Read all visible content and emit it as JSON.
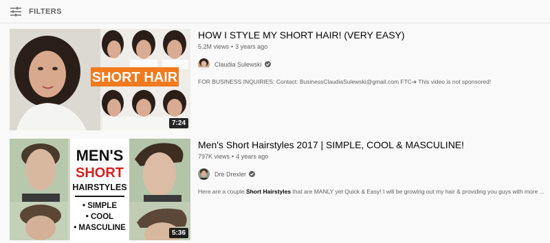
{
  "filters": {
    "label": "FILTERS"
  },
  "results": [
    {
      "title": "HOW I STYLE MY SHORT HAIR! (VERY EASY)",
      "views": "5.2M views",
      "age": "3 years ago",
      "channel": "Claudia Sulewski",
      "verified": true,
      "description": "FOR BUSINESS INQUIRIES: Contact: BusinessClaudiaSulewski@gmail.com FTC➔ This video is not sponsored!",
      "duration": "7:24",
      "thumb_text": "SHORT HAIR"
    },
    {
      "title": "Men's Short Hairstyles 2017 | SIMPLE, COOL & MASCULINE!",
      "views": "797K views",
      "age": "4 years ago",
      "channel": "Dre Drexler",
      "verified": true,
      "description_pre": "Here are a couple ",
      "description_bold": "Short Hairstyles",
      "description_post": " that are MANLY yet Quick & Easy! I will be growing out my hair & providing you guys with more ...",
      "duration": "5:36",
      "thumb_lines": [
        "MEN'S",
        "SHORT",
        "HAIRSTYLES",
        "• SIMPLE",
        "• COOL",
        "• MASCULINE"
      ]
    }
  ],
  "colors": {
    "accent_orange": "#f07a1e",
    "accent_red": "#d32020",
    "background": "#f9f9f9"
  }
}
